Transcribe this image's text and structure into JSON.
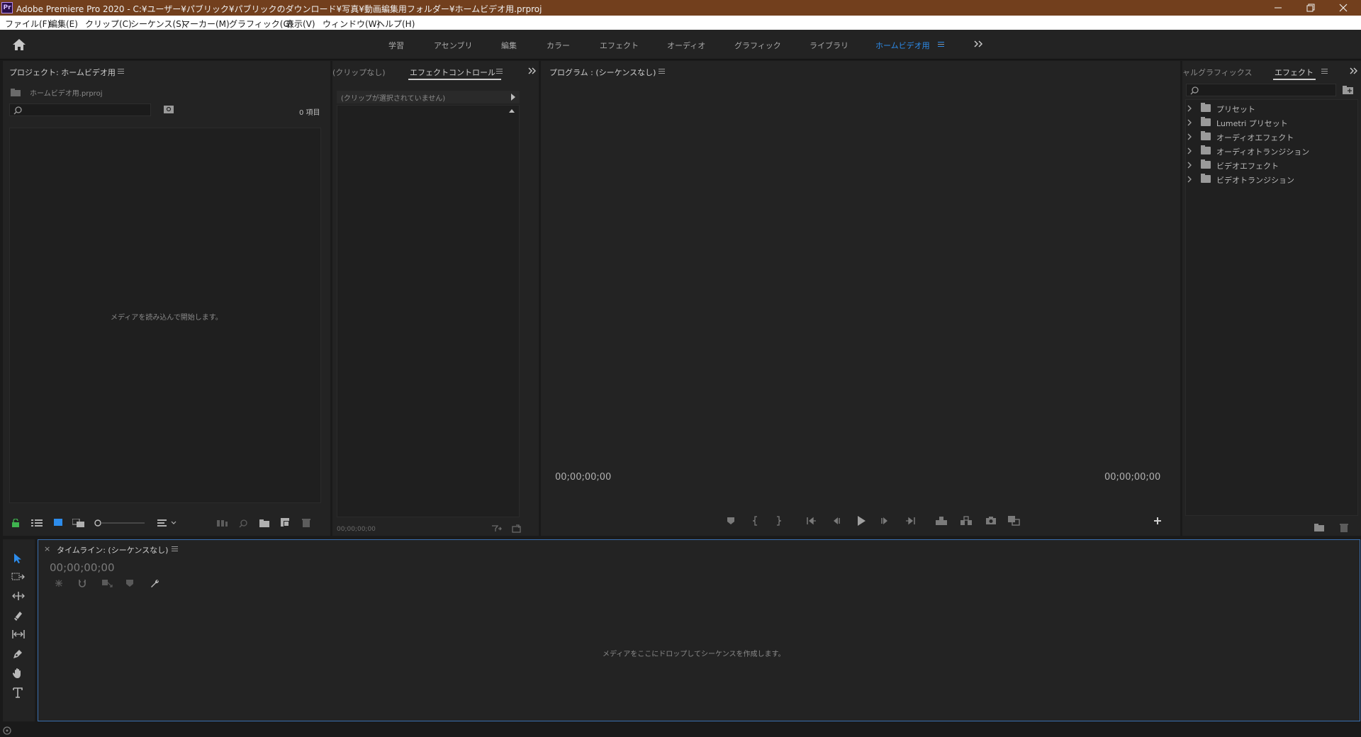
{
  "titlebar": {
    "app_icon": "Pr",
    "title": "Adobe Premiere Pro 2020 - C:¥ユーザー¥パブリック¥パブリックのダウンロード¥写真¥動画編集用フォルダー¥ホームビデオ用.prproj"
  },
  "menubar": [
    "ファイル(F)",
    "編集(E)",
    "クリップ(C)",
    "シーケンス(S)",
    "マーカー(M)",
    "グラフィック(G)",
    "表示(V)",
    "ウィンドウ(W)",
    "ヘルプ(H)"
  ],
  "workspaces": [
    "学習",
    "アセンブリ",
    "編集",
    "カラー",
    "エフェクト",
    "オーディオ",
    "グラフィック",
    "ライブラリ",
    "ホームビデオ用"
  ],
  "project": {
    "title": "プロジェクト: ホームビデオ用",
    "file": "ホームビデオ用.prproj",
    "count": "0 項目",
    "empty_message": "メディアを読み込んで開始します。"
  },
  "effect_controls": {
    "tab_inactive": "(クリップなし)",
    "tab_active": "エフェクトコントロール",
    "no_clip": "(クリップが選択されていません)",
    "timecode": "00;00;00;00"
  },
  "program": {
    "title": "プログラム : (シーケンスなし)",
    "timecode_left": "00;00;00;00",
    "timecode_right": "00;00;00;00"
  },
  "effects": {
    "tab_inactive": "ャルグラフィックス",
    "tab_active": "エフェクト",
    "items": [
      "プリセット",
      "Lumetri プリセット",
      "オーディオエフェクト",
      "オーディオトランジション",
      "ビデオエフェクト",
      "ビデオトランジション"
    ]
  },
  "timeline": {
    "close": "×",
    "title": "タイムライン: (シーケンスなし)",
    "timecode": "00;00;00;00",
    "empty_message": "メディアをここにドロップしてシーケンスを作成します。"
  },
  "colors": {
    "titlebar": "#723f1d",
    "accent": "#2d8ceb",
    "panel": "#232323",
    "frame": "#1a1a1a"
  }
}
